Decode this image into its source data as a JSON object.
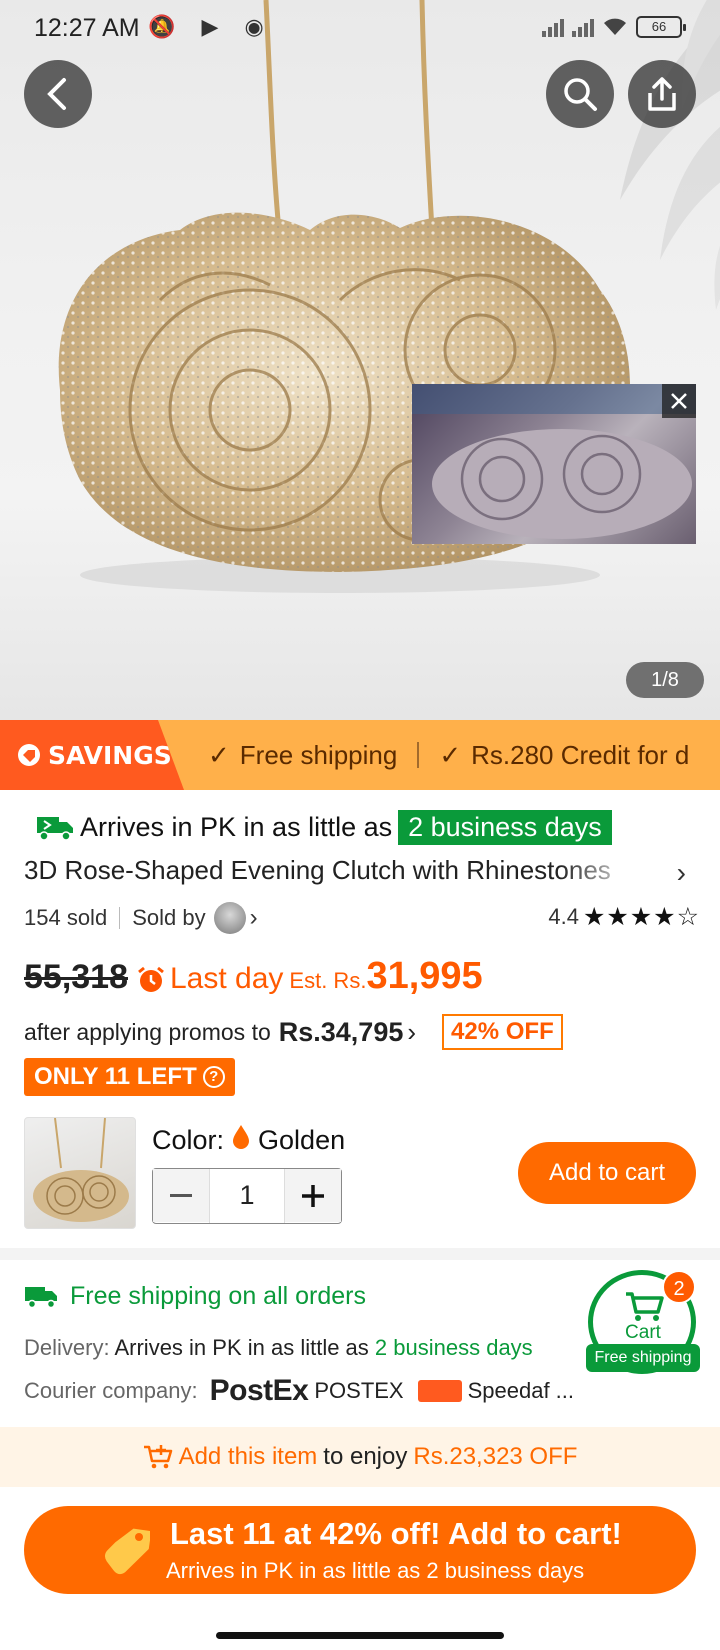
{
  "status": {
    "time": "12:27 AM",
    "battery": "66"
  },
  "gallery": {
    "indicator": "1/8"
  },
  "savings": {
    "tag": "SAVINGS",
    "items": [
      "Free shipping",
      "Rs.280 Credit for d"
    ]
  },
  "arrives": {
    "text": "Arrives in PK in as little as",
    "badge": "2 business days"
  },
  "product": {
    "title": "3D Rose-Shaped Evening Clutch with Rhinestones",
    "sold": "154 sold",
    "sold_by": "Sold by",
    "rating": "4.4",
    "rating_value": 4.4,
    "old_price": "55,318",
    "last_day": "Last day",
    "est_label": "Est. Rs.",
    "new_price": "31,995",
    "promo_text": "after applying promos to",
    "promo_price": "Rs.34,795",
    "discount": "42% OFF",
    "only_left": "ONLY 11 LEFT"
  },
  "variant": {
    "color_label": "Color:",
    "color_value": "Golden",
    "quantity": "1",
    "add_to_cart": "Add to cart"
  },
  "shipping": {
    "free_shipping": "Free shipping on all orders",
    "delivery_label": "Delivery:",
    "delivery_text": "Arrives in PK in as little as",
    "delivery_days": "2 business days",
    "courier_label": "Courier company:",
    "postex_logo": "PostEx",
    "courier_name_1": "POSTEX",
    "courier_name_2": "Speedaf ..."
  },
  "cart": {
    "label": "Cart",
    "free": "Free shipping",
    "count": "2"
  },
  "enjoy": {
    "add_item": "Add this item",
    "to_enjoy": "to enjoy",
    "amount": "Rs.23,323 OFF"
  },
  "cta": {
    "main": "Last 11 at 42% off! Add to cart!",
    "sub": "Arrives in PK in as little as 2 business days"
  },
  "colors": {
    "accent_orange": "#ff6a00",
    "green": "#0a9a3a",
    "savings_bg": "#ffb04a"
  }
}
